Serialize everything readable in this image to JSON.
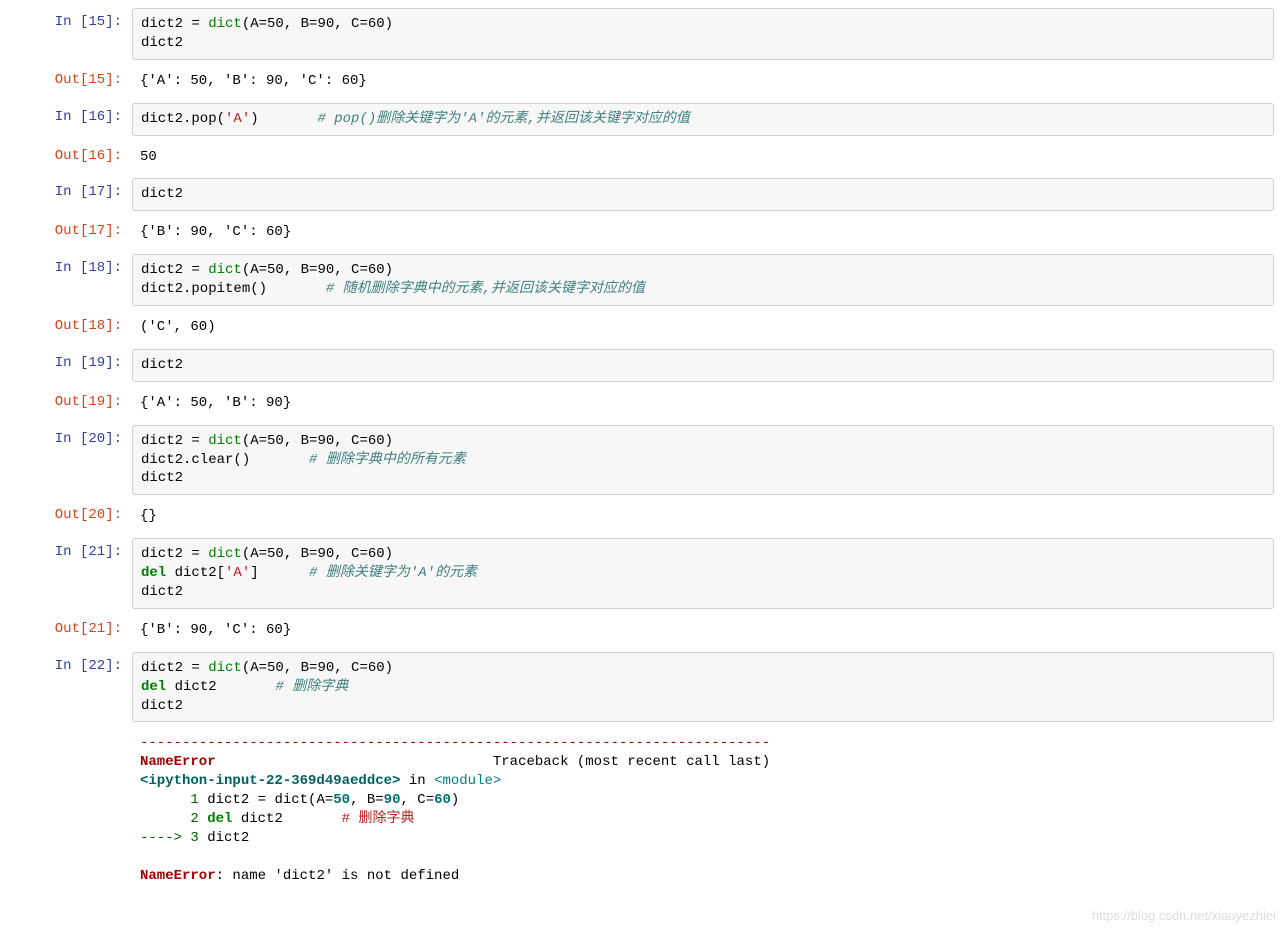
{
  "cells": [
    {
      "in_prompt": "In  [15]:",
      "code_html": "dict2 = <span class='tok-builtin'>dict</span>(A=50, B=90, C=60)\ndict2",
      "out_prompt": "Out[15]:",
      "output": "{'A': 50, 'B': 90, 'C': 60}"
    },
    {
      "in_prompt": "In  [16]:",
      "code_html": "dict2.pop(<span class='tok-string'>'A'</span>)       <span class='tok-comment'># pop()删除关键字为'A'的元素,并返回该关键字对应的值</span>",
      "out_prompt": "Out[16]:",
      "output": "50"
    },
    {
      "in_prompt": "In  [17]:",
      "code_html": "dict2",
      "out_prompt": "Out[17]:",
      "output": "{'B': 90, 'C': 60}"
    },
    {
      "in_prompt": "In  [18]:",
      "code_html": "dict2 = <span class='tok-builtin'>dict</span>(A=50, B=90, C=60)\ndict2.popitem()       <span class='tok-comment'># 随机删除字典中的元素,并返回该关键字对应的值</span>",
      "out_prompt": "Out[18]:",
      "output": "('C', 60)"
    },
    {
      "in_prompt": "In  [19]:",
      "code_html": "dict2",
      "out_prompt": "Out[19]:",
      "output": "{'A': 50, 'B': 90}"
    },
    {
      "in_prompt": "In  [20]:",
      "code_html": "dict2 = <span class='tok-builtin'>dict</span>(A=50, B=90, C=60)\ndict2.clear()       <span class='tok-comment'># 删除字典中的所有元素</span>\ndict2",
      "out_prompt": "Out[20]:",
      "output": "{}"
    },
    {
      "in_prompt": "In  [21]:",
      "code_html": "dict2 = <span class='tok-builtin'>dict</span>(A=50, B=90, C=60)\n<span class='tok-keyword'>del</span> dict2[<span class='tok-string'>'A'</span>]      <span class='tok-comment'># 删除关键字为'A'的元素</span>\ndict2",
      "out_prompt": "Out[21]:",
      "output": "{'B': 90, 'C': 60}"
    },
    {
      "in_prompt": "In  [22]:",
      "code_html": "dict2 = <span class='tok-builtin'>dict</span>(A=50, B=90, C=60)\n<span class='tok-keyword'>del</span> dict2       <span class='tok-comment'># 删除字典</span>\ndict2",
      "out_prompt": "",
      "output": "",
      "has_traceback": true
    }
  ],
  "traceback": {
    "dashline": "---------------------------------------------------------------------------",
    "err_name": "NameError",
    "header_tail": "                                 Traceback (most recent call last)",
    "loc_html": "<span class='tb-info'>&lt;ipython-input-22-369d49aeddce&gt;</span> in <span class='tb-cyan'>&lt;module&gt;</span>",
    "line1_html": "      <span class='tb-arrow'>1</span> dict2 = dict(A=<span class='tb-num'>50</span>, B=<span class='tb-num'>90</span>, C=<span class='tb-num'>60</span>)",
    "line2_html": "      <span class='tb-arrow'>2</span> <span class='tb-kw'>del</span> dict2       <span class='tb-str'># 删除字典</span>",
    "line3_html": "<span class='tb-arrow'>----&gt; 3</span> dict2",
    "final": ": name 'dict2' is not defined"
  },
  "watermark": "https://blog.csdn.net/xiaoyezhiei"
}
